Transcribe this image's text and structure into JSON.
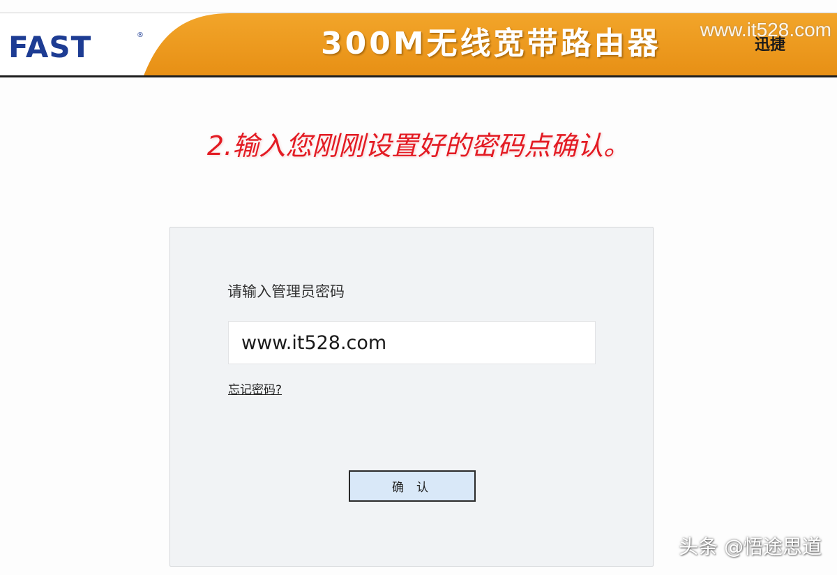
{
  "header": {
    "logo_text": "FAST",
    "logo_mark": "®",
    "product_title": "300M无线宽带路由器",
    "brand_cn": "迅捷",
    "watermark": "www.it528.com",
    "accent_color": "#ec9a1f",
    "logo_color": "#1d3c93"
  },
  "instruction": {
    "text": "2.输入您刚刚设置好的密码点确认。",
    "color": "#e31b23"
  },
  "login": {
    "label": "请输入管理员密码",
    "password_value": "www.it528.com",
    "forgot_label": "忘记密码?",
    "confirm_label": "确认",
    "button_color": "#d9e8f8"
  },
  "footer": {
    "watermark": "头条 @悟途思道"
  }
}
